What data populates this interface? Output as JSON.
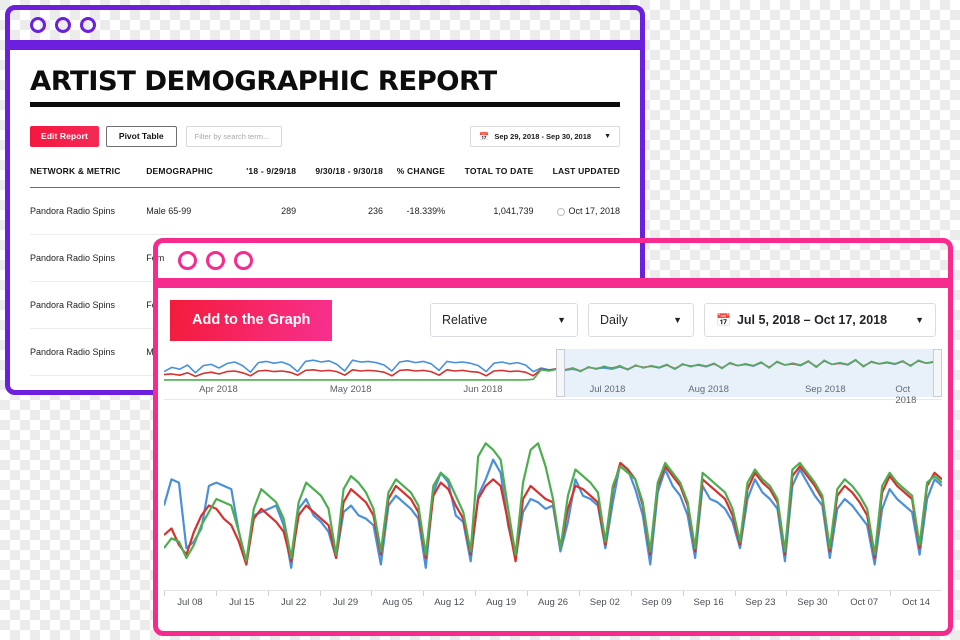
{
  "purple_window": {
    "accent_color": "#6c20dd",
    "traffic_lights": [
      "circle-1",
      "circle-2",
      "circle-3"
    ],
    "page_title": "ARTIST DEMOGRAPHIC REPORT",
    "toolbar": {
      "edit_report_label": "Edit Report",
      "pivot_table_label": "Pivot Table",
      "search_placeholder": "Filter by search term...",
      "search_value": "",
      "date_range_label": "Sep 29, 2018 - Sep 30, 2018",
      "calendar_icon": "calendar-icon",
      "chevron_icon": "chevron-down-icon"
    },
    "table": {
      "columns": [
        "NETWORK & METRIC",
        "DEMOGRAPHIC",
        "'18 - 9/29/18",
        "9/30/18 - 9/30/18",
        "% CHANGE",
        "TOTAL TO DATE",
        "LAST UPDATED"
      ],
      "rows": [
        {
          "network": "Pandora Radio Spins",
          "demographic": "Male 65-99",
          "prev": "289",
          "curr": "236",
          "change": "-18.339%",
          "total": "1,041,739",
          "updated": "Oct 17, 2018"
        },
        {
          "network": "Pandora Radio Spins",
          "demographic": "Fem",
          "prev": "",
          "curr": "",
          "change": "",
          "total": "",
          "updated": ""
        },
        {
          "network": "Pandora Radio Spins",
          "demographic": "Fem",
          "prev": "",
          "curr": "",
          "change": "",
          "total": "",
          "updated": ""
        },
        {
          "network": "Pandora Radio Spins",
          "demographic": "Ma",
          "prev": "",
          "curr": "",
          "change": "",
          "total": "",
          "updated": ""
        }
      ]
    }
  },
  "pink_window": {
    "accent_color": "#f72a8e",
    "traffic_lights": [
      "circle-1",
      "circle-2",
      "circle-3"
    ],
    "toolbar": {
      "add_to_graph_label": "Add to the Graph",
      "mode_selected": "Relative",
      "mode_options": [
        "Relative"
      ],
      "interval_selected": "Daily",
      "interval_options": [
        "Daily"
      ],
      "date_range_label": "Jul 5, 2018 – Oct 17, 2018",
      "calendar_icon": "calendar-icon",
      "chevron_icon": "chevron-down-icon"
    }
  },
  "chart_data": [
    {
      "type": "line",
      "name": "overview-brush-chart",
      "title": "",
      "xlabel": "",
      "ylabel": "",
      "grid": false,
      "legend": "none",
      "x_tick_labels": [
        "Apr 2018",
        "May 2018",
        "Jun 2018",
        "Jul 2018",
        "Aug 2018",
        "Sep 2018",
        "Oct 2018"
      ],
      "x_tick_positions_pct": [
        7,
        24,
        41,
        57,
        70,
        85,
        96
      ],
      "brush_selection": {
        "start_pct": 50.4,
        "end_pct": 100,
        "start_label": "Jul 2018",
        "end_label": "Oct 2018"
      },
      "colors": {
        "blue": "#4a90d9",
        "red": "#d5312e",
        "green": "#4cae4f"
      },
      "series": [
        {
          "name": "blue",
          "color": "#4a90d9",
          "values": [
            38,
            52,
            46,
            60,
            34,
            58,
            62,
            50,
            65,
            70,
            58,
            36,
            68,
            72,
            66,
            70,
            60,
            38,
            72,
            76,
            70,
            74,
            62,
            40,
            76,
            70,
            72,
            68,
            60,
            40,
            70,
            74,
            68,
            72,
            64,
            42,
            72,
            68,
            70,
            66,
            58,
            38,
            66,
            70,
            64,
            68,
            60,
            38,
            50,
            44,
            48,
            42,
            46,
            40,
            52,
            48,
            50,
            46,
            54,
            44,
            58,
            52,
            56,
            50,
            60,
            46,
            62,
            56,
            60,
            54,
            64,
            50,
            66,
            58,
            62,
            56,
            68,
            52,
            70,
            60,
            64,
            58,
            72,
            54,
            74,
            62,
            66,
            60,
            76,
            56,
            70,
            64,
            68,
            62,
            72,
            58,
            74,
            66,
            70,
            64
          ]
        },
        {
          "name": "red",
          "color": "#d5312e",
          "values": [
            28,
            30,
            26,
            34,
            22,
            32,
            36,
            30,
            38,
            40,
            34,
            24,
            40,
            42,
            38,
            40,
            36,
            26,
            42,
            44,
            40,
            42,
            38,
            26,
            44,
            40,
            42,
            40,
            36,
            24,
            42,
            44,
            40,
            42,
            38,
            26,
            44,
            40,
            42,
            38,
            36,
            24,
            40,
            42,
            38,
            40,
            36,
            24,
            46,
            42,
            48,
            44,
            50,
            40,
            52,
            48,
            54,
            50,
            56,
            46,
            58,
            52,
            56,
            52,
            60,
            48,
            62,
            56,
            60,
            56,
            64,
            50,
            66,
            58,
            62,
            58,
            68,
            52,
            70,
            60,
            64,
            60,
            72,
            54,
            74,
            62,
            66,
            62,
            76,
            56,
            70,
            64,
            68,
            64,
            72,
            58,
            74,
            66,
            70,
            66
          ]
        },
        {
          "name": "green",
          "color": "#4cae4f",
          "values": [
            10,
            10,
            10,
            10,
            10,
            10,
            10,
            10,
            10,
            10,
            10,
            10,
            10,
            10,
            10,
            10,
            10,
            10,
            10,
            10,
            10,
            10,
            10,
            10,
            10,
            10,
            10,
            10,
            10,
            10,
            10,
            10,
            10,
            10,
            10,
            10,
            10,
            10,
            10,
            10,
            10,
            10,
            10,
            10,
            10,
            10,
            10,
            12,
            44,
            40,
            46,
            42,
            50,
            38,
            54,
            46,
            56,
            48,
            58,
            44,
            60,
            50,
            58,
            52,
            62,
            46,
            64,
            54,
            62,
            56,
            66,
            48,
            68,
            58,
            64,
            58,
            70,
            50,
            72,
            60,
            66,
            60,
            74,
            52,
            76,
            62,
            68,
            62,
            78,
            54,
            72,
            64,
            70,
            64,
            74,
            56,
            76,
            66,
            72,
            66
          ]
        }
      ]
    },
    {
      "type": "line",
      "name": "main-detail-chart",
      "title": "",
      "xlabel": "",
      "ylabel": "",
      "grid": false,
      "legend": "none",
      "x_tick_labels": [
        "Jul 08",
        "Jul 15",
        "Jul 22",
        "Jul 29",
        "Aug 05",
        "Aug 12",
        "Aug 19",
        "Aug 26",
        "Sep 02",
        "Sep 09",
        "Sep 16",
        "Sep 23",
        "Sep 30",
        "Oct 07",
        "Oct 14"
      ],
      "colors": {
        "blue": "#4a90d9",
        "red": "#d5312e",
        "green": "#4cae4f"
      },
      "series": [
        {
          "name": "blue",
          "color": "#4a90d9",
          "values": [
            46,
            62,
            60,
            20,
            24,
            32,
            58,
            60,
            58,
            56,
            30,
            10,
            40,
            42,
            44,
            46,
            34,
            8,
            44,
            50,
            40,
            36,
            30,
            14,
            42,
            46,
            40,
            38,
            34,
            10,
            46,
            52,
            48,
            44,
            38,
            8,
            54,
            66,
            60,
            40,
            36,
            12,
            52,
            62,
            74,
            66,
            34,
            14,
            42,
            50,
            48,
            44,
            46,
            18,
            36,
            62,
            52,
            50,
            46,
            20,
            48,
            72,
            68,
            56,
            40,
            10,
            54,
            68,
            58,
            52,
            40,
            14,
            58,
            50,
            48,
            44,
            36,
            20,
            50,
            62,
            54,
            50,
            44,
            12,
            58,
            68,
            60,
            52,
            46,
            14,
            44,
            50,
            46,
            40,
            34,
            10,
            44,
            56,
            50,
            46,
            42,
            16,
            50,
            62,
            58
          ]
        },
        {
          "name": "red",
          "color": "#d5312e",
          "values": [
            28,
            32,
            22,
            16,
            30,
            40,
            46,
            44,
            38,
            34,
            24,
            10,
            38,
            44,
            40,
            36,
            30,
            12,
            40,
            46,
            42,
            38,
            34,
            14,
            48,
            56,
            52,
            48,
            40,
            16,
            50,
            58,
            54,
            50,
            42,
            14,
            52,
            60,
            56,
            46,
            38,
            16,
            50,
            58,
            62,
            58,
            36,
            12,
            50,
            58,
            54,
            50,
            48,
            20,
            44,
            58,
            56,
            52,
            48,
            22,
            56,
            72,
            68,
            62,
            46,
            16,
            58,
            70,
            64,
            58,
            46,
            18,
            62,
            58,
            54,
            50,
            40,
            22,
            56,
            66,
            60,
            56,
            48,
            16,
            64,
            70,
            64,
            58,
            50,
            18,
            52,
            58,
            54,
            48,
            40,
            14,
            54,
            64,
            58,
            54,
            50,
            20,
            58,
            66,
            62
          ]
        },
        {
          "name": "green",
          "color": "#4cae4f",
          "values": [
            20,
            26,
            24,
            14,
            22,
            34,
            42,
            50,
            48,
            46,
            30,
            12,
            44,
            56,
            52,
            48,
            38,
            14,
            48,
            60,
            56,
            52,
            44,
            16,
            56,
            64,
            60,
            54,
            44,
            18,
            54,
            62,
            58,
            54,
            46,
            16,
            58,
            66,
            62,
            52,
            42,
            18,
            76,
            84,
            80,
            74,
            44,
            16,
            60,
            80,
            84,
            70,
            50,
            20,
            52,
            68,
            64,
            60,
            54,
            24,
            58,
            70,
            66,
            62,
            48,
            18,
            60,
            72,
            66,
            60,
            48,
            20,
            66,
            62,
            58,
            54,
            44,
            24,
            60,
            68,
            62,
            58,
            50,
            18,
            68,
            72,
            66,
            60,
            52,
            20,
            56,
            62,
            58,
            52,
            44,
            16,
            58,
            66,
            60,
            56,
            52,
            22,
            60,
            64,
            60
          ]
        }
      ]
    }
  ]
}
